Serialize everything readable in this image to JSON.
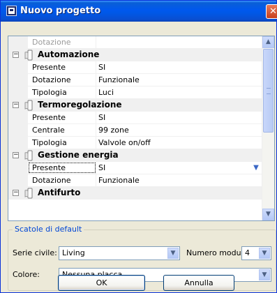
{
  "window": {
    "title": "Nuovo progetto",
    "close_symbol": "✕"
  },
  "grid": {
    "rows": [
      {
        "kind": "prop",
        "name": "Dotazione",
        "value": "",
        "muted": true
      },
      {
        "kind": "cat",
        "label": "Automazione"
      },
      {
        "kind": "prop",
        "name": "Presente",
        "value": "SI"
      },
      {
        "kind": "prop",
        "name": "Dotazione",
        "value": "Funzionale"
      },
      {
        "kind": "prop",
        "name": "Tipologia",
        "value": "Luci"
      },
      {
        "kind": "cat",
        "label": "Termoregolazione"
      },
      {
        "kind": "prop",
        "name": "Presente",
        "value": "SI"
      },
      {
        "kind": "prop",
        "name": "Centrale",
        "value": "99 zone"
      },
      {
        "kind": "prop",
        "name": "Tipologia",
        "value": "Valvole on/off"
      },
      {
        "kind": "cat",
        "label": "Gestione energia"
      },
      {
        "kind": "prop",
        "name": "Presente",
        "value": "SI",
        "selected": true
      },
      {
        "kind": "prop",
        "name": "Dotazione",
        "value": "Funzionale"
      },
      {
        "kind": "cat",
        "label": "Antifurto"
      }
    ]
  },
  "defaults": {
    "group_label": "Scatole di default",
    "serie_label": "Serie civile:",
    "serie_value": "Living",
    "moduli_label": "Numero moduli:",
    "moduli_value": "4",
    "colore_label": "Colore:",
    "colore_value": "Nessuna placca"
  },
  "buttons": {
    "ok": "OK",
    "cancel": "Annulla"
  },
  "icons": {
    "app": "app-icon",
    "collapse": "collapse-icon",
    "category": "category-icon",
    "dropdown": "chevron-down-icon",
    "scroll_up": "scroll-up-icon",
    "scroll_down": "scroll-down-icon"
  },
  "colors": {
    "titlebar": "#0058ee",
    "group_label": "#0046d5",
    "grid_border": "#7f9db9"
  }
}
